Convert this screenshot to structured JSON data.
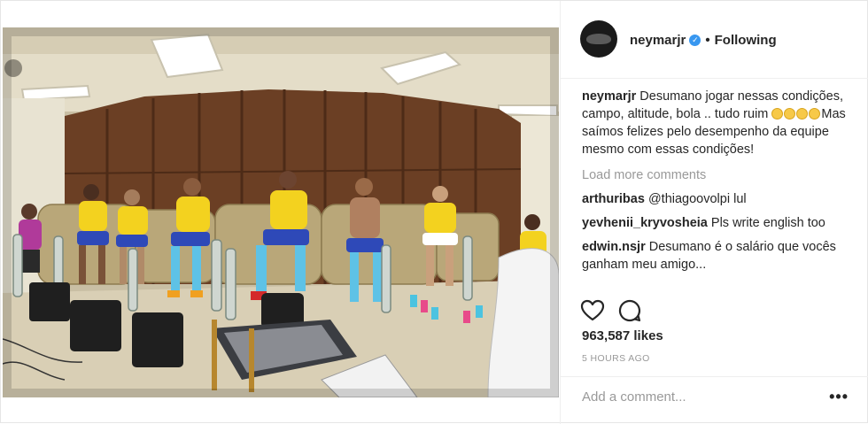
{
  "post": {
    "author": {
      "username": "neymarjr",
      "verified_icon": "verified-badge-icon",
      "follow_separator": "•",
      "follow_status": "Following"
    },
    "caption": {
      "username": "neymarjr",
      "text_before_emoji": "Desumano jogar nessas condições, campo, altitude, bola .. tudo ruim",
      "emoji_icon": "laughing-tears-emoji",
      "emoji_count": 4,
      "text_after_emoji": "Mas saímos felizes pelo desempenho da equipe mesmo com essas condições!"
    },
    "load_more": "Load more comments",
    "comments": [
      {
        "username": "arthuribas",
        "text": "@thiagoovolpi lul"
      },
      {
        "username": "yevhenii_kryvosheia",
        "text": "Pls write english too"
      },
      {
        "username": "edwin.nsjr",
        "text": "Desumano é o salário que vocês ganham meu amigo..."
      }
    ],
    "actions": {
      "like_icon": "heart-icon",
      "comment_icon": "comment-bubble-icon"
    },
    "likes": "963,587 likes",
    "timestamp": "5 HOURS AGO",
    "add_comment_placeholder": "Add a comment...",
    "more_options": "•••"
  },
  "colors": {
    "text": "#262626",
    "muted": "#999999",
    "verified": "#3897f0",
    "border": "#efefef"
  }
}
